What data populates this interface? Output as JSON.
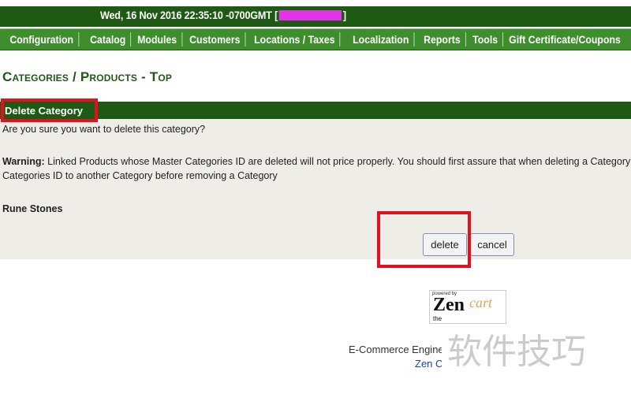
{
  "header": {
    "datetime": "Wed, 16 Nov 2016 22:35:10 -0700GMT [",
    "datetime_suffix": "]",
    "redacted_color": "#e235e8"
  },
  "menu": [
    "Configuration",
    "Catalog",
    "Modules",
    "Customers",
    "Locations / Taxes",
    "Localization",
    "Reports",
    "Tools",
    "Gift Certificate/Coupons"
  ],
  "page": {
    "title": "Categories / Products - Top"
  },
  "dialog": {
    "header": "Delete Category",
    "question": "Are you sure you want to delete this category?",
    "warning_label": "Warning:",
    "warning_line1": " Linked Products whose Master Categories ID are deleted will not price properly. You should first assure that when deleting a Category tha",
    "warning_line2": "Categories ID to another Category before removing a Category",
    "category_name": "Rune Stones",
    "delete_label": "delete",
    "cancel_label": "cancel"
  },
  "logo": {
    "powered": "powered by",
    "zen": "Zen",
    "cart": "cart",
    "the": "the"
  },
  "footer": {
    "engine": "E-Commerce Engine C",
    "link": "Zen Ca"
  },
  "watermark": "软件技巧",
  "colors": {
    "header_dark_green": "#1e5a14",
    "menu_green": "#3e8e2e",
    "panel_gray": "#eeede8",
    "highlight_red": "#e3101d"
  }
}
